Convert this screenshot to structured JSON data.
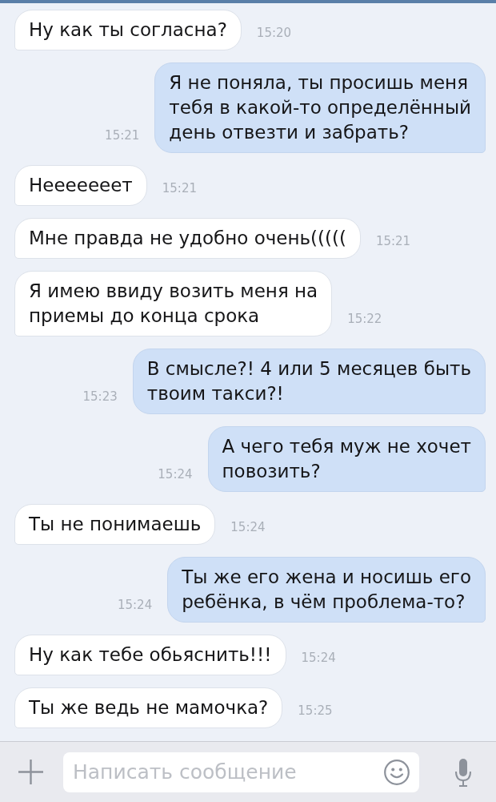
{
  "messages": [
    {
      "kind": "incoming",
      "text": "Ну как ты согласна?",
      "time": "15:20"
    },
    {
      "kind": "outgoing",
      "text": "Я не поняла, ты просишь меня\nтебя в какой-то определённый\nдень отвезти и забрать?",
      "time": "15:21"
    },
    {
      "kind": "incoming",
      "text": "Нееееееет",
      "time": "15:21"
    },
    {
      "kind": "incoming",
      "text": "Мне правда не удобно очень(((((",
      "time": "15:21"
    },
    {
      "kind": "incoming",
      "text": "Я имею ввиду возить меня на\nприемы до конца срока",
      "time": "15:22"
    },
    {
      "kind": "outgoing",
      "text": "В смысле?! 4 или 5 месяцев быть\nтвоим такси?!",
      "time": "15:23"
    },
    {
      "kind": "outgoing",
      "text": "А чего тебя муж не хочет\nповозить?",
      "time": "15:24"
    },
    {
      "kind": "incoming",
      "text": "Ты не понимаешь",
      "time": "15:24"
    },
    {
      "kind": "outgoing",
      "text": "Ты же его жена и носишь его\nребёнка, в чём проблема-то?",
      "time": "15:24"
    },
    {
      "kind": "incoming",
      "text": "Ну как тебе обьяснить!!!",
      "time": "15:24"
    },
    {
      "kind": "incoming",
      "text": "Ты же ведь не мамочка?",
      "time": "15:25"
    }
  ],
  "composer": {
    "placeholder": "Написать сообщение"
  }
}
